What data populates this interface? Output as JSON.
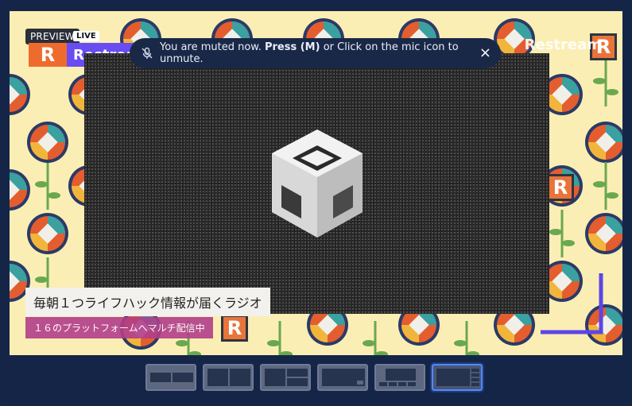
{
  "overlay": {
    "preview_label": "PREVIEW",
    "live_label": "LIVE",
    "brand_initial": "R",
    "brand_name": "Restream",
    "watermark": "Restream"
  },
  "mute_notice": {
    "text_before": "You are muted now. ",
    "text_bold": "Press (M)",
    "text_after": " or Click on the mic icon to unmute.",
    "close_symbol": "×"
  },
  "captions": {
    "headline": "毎朝１つライフハック情報が届くラジオ",
    "subline": "１６のプラットフォームへマルチ配信中"
  },
  "layouts": {
    "items": [
      "layout-1",
      "layout-2",
      "layout-3",
      "layout-4",
      "layout-5",
      "layout-6"
    ],
    "selected_index": 5
  },
  "colors": {
    "background": "#142548",
    "stage": "#fbeeb4",
    "brand_orange": "#ef6b2d",
    "brand_purple": "#6a4df2",
    "active_outline": "#4f89ff"
  },
  "icons": {
    "mic": "mic-muted-icon",
    "close": "close-icon",
    "center_logo": "restream-cube-logo-icon"
  }
}
